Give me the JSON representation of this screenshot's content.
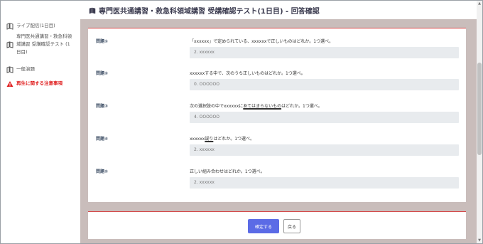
{
  "header": {
    "title": "専門医共通講習・救急科領域講習 受講確認テスト(1日目) - 回答確認"
  },
  "sidebar": {
    "items": [
      {
        "label": "ライブ配信(1日目)",
        "icon": "book-icon"
      },
      {
        "label_lines": [
          "専門医共通講習・救急科領",
          "域講習 受講確認テスト (1",
          "日目)"
        ],
        "icon": "book-icon"
      },
      {
        "label": "一般演題",
        "icon": "book-icon"
      },
      {
        "label": "再生に関する注意事項",
        "icon": "warning-icon"
      }
    ]
  },
  "questions": [
    {
      "label": "問題①",
      "text": "「xxxxxx」で定められている、xxxxxxで正しいものはどれか。1つ選べ。",
      "answer": "2. xxxxxx"
    },
    {
      "label": "問題②",
      "text": "xxxxxxする中で、次のうち正しいものはどれか。1つ選べ。",
      "answer": "0. OOOOOO"
    },
    {
      "label": "問題③",
      "text_pre": "次の選択肢の中でxxxxxxに",
      "text_ul": "あてはまらないもの",
      "text_post": "はどれか。1つ選べ。",
      "answer": "4. OOOOOO"
    },
    {
      "label": "問題④",
      "text_pre": "xxxxxx",
      "text_ul": "誤り",
      "text_post": "はどれか。1つ選べ。",
      "answer": "2. xxxxxx"
    },
    {
      "label": "問題⑤",
      "text": "正しい組み合わせはどれか。1つ選べ。",
      "answer": "2. xxxxxx"
    }
  ],
  "footer": {
    "submit_label": "確定する",
    "back_label": "戻る"
  },
  "colors": {
    "accent": "#5b6be6",
    "warning": "#e02020",
    "content_bg": "#c9bdbb",
    "divider": "#d64545"
  }
}
